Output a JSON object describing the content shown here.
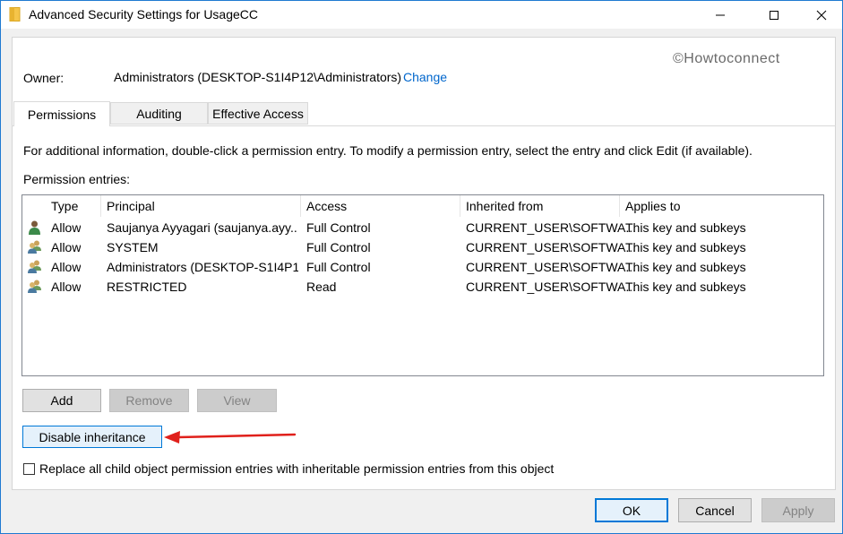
{
  "window": {
    "title": "Advanced Security Settings for UsageCC",
    "minimize_label": "Minimize",
    "maximize_label": "Maximize",
    "close_label": "Close"
  },
  "watermark": "©Howtoconnect",
  "owner": {
    "label": "Owner:",
    "value": "Administrators (DESKTOP-S1I4P12\\Administrators)",
    "change_link": "Change"
  },
  "tabs": [
    {
      "label": "Permissions",
      "active": true
    },
    {
      "label": "Auditing",
      "active": false
    },
    {
      "label": "Effective Access",
      "active": false
    }
  ],
  "info_text": "For additional information, double-click a permission entry. To modify a permission entry, select the entry and click Edit (if available).",
  "entries_label": "Permission entries:",
  "table": {
    "columns": [
      "Type",
      "Principal",
      "Access",
      "Inherited from",
      "Applies to"
    ],
    "rows": [
      {
        "icon": "user-icon",
        "type": "Allow",
        "principal": "Saujanya Ayyagari (saujanya.ayy...",
        "access": "Full Control",
        "inherited_from": "CURRENT_USER\\SOFTWA...",
        "applies_to": "This key and subkeys"
      },
      {
        "icon": "group-icon",
        "type": "Allow",
        "principal": "SYSTEM",
        "access": "Full Control",
        "inherited_from": "CURRENT_USER\\SOFTWA...",
        "applies_to": "This key and subkeys"
      },
      {
        "icon": "group-icon",
        "type": "Allow",
        "principal": "Administrators (DESKTOP-S1I4P1...",
        "access": "Full Control",
        "inherited_from": "CURRENT_USER\\SOFTWA...",
        "applies_to": "This key and subkeys"
      },
      {
        "icon": "group-icon",
        "type": "Allow",
        "principal": "RESTRICTED",
        "access": "Read",
        "inherited_from": "CURRENT_USER\\SOFTWA...",
        "applies_to": "This key and subkeys"
      }
    ]
  },
  "buttons": {
    "add": "Add",
    "remove": "Remove",
    "view": "View",
    "disable_inheritance": "Disable inheritance",
    "ok": "OK",
    "cancel": "Cancel",
    "apply": "Apply"
  },
  "replace_checkbox": {
    "label": "Replace all child object permission entries with inheritable permission entries from this object",
    "checked": false
  },
  "colors": {
    "accent": "#0078d7",
    "link": "#0066cc",
    "arrow": "#e0201b"
  }
}
